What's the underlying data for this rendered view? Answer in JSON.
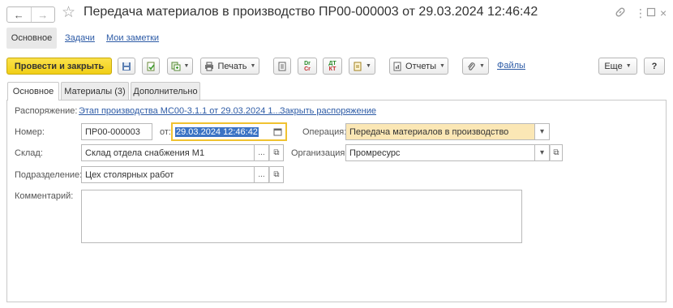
{
  "window": {
    "title": "Передача материалов в производство ПР00-000003 от 29.03.2024 12:46:42"
  },
  "icons": {
    "back": "arrow-left-icon",
    "forward": "arrow-right-icon",
    "favorite": "star-icon",
    "link": "link-icon",
    "more": "more-vertical-icon",
    "maximize": "maximize-icon",
    "close": "close-icon"
  },
  "top_tabs": {
    "main": "Основное",
    "tasks": "Задачи",
    "notes": "Мои заметки"
  },
  "toolbar": {
    "post_close": "Провести и закрыть",
    "print": "Печать",
    "reports": "Отчеты",
    "files": "Файлы",
    "more": "Еще",
    "help": "?",
    "dr_cr_top": "Dr",
    "dr_cr_bottom": "Cr",
    "dt_kt_top": "ДТ",
    "dt_kt_bottom": "КТ"
  },
  "form_tabs": {
    "main": "Основное",
    "materials": "Материалы (3)",
    "additional": "Дополнительно"
  },
  "form": {
    "order_label": "Распоряжение:",
    "order_link": "Этап производства МС00-3.1.1 от 29.03.2024 1...",
    "close_order_link": "Закрыть распоряжение",
    "number_label": "Номер:",
    "number_value": "ПР00-000003",
    "from_label": "от:",
    "date_value": "29.03.2024 12:46:42",
    "operation_label": "Операция:",
    "operation_value": "Передача материалов в производство",
    "warehouse_label": "Склад:",
    "warehouse_value": "Склад отдела снабжения М1",
    "organization_label": "Организация:",
    "organization_value": "Промресурс",
    "department_label": "Подразделение:",
    "department_value": "Цех столярных работ",
    "comment_label": "Комментарий:",
    "comment_value": "",
    "ellipsis": "...",
    "open_symbol": "⧉",
    "dropdown_symbol": "▾"
  },
  "colors": {
    "primary_button": "#f1cf16",
    "link": "#2d5ba6",
    "date_focus_border": "#f0c230",
    "operation_bg": "#fbe7b5",
    "selection": "#3b73c4"
  }
}
